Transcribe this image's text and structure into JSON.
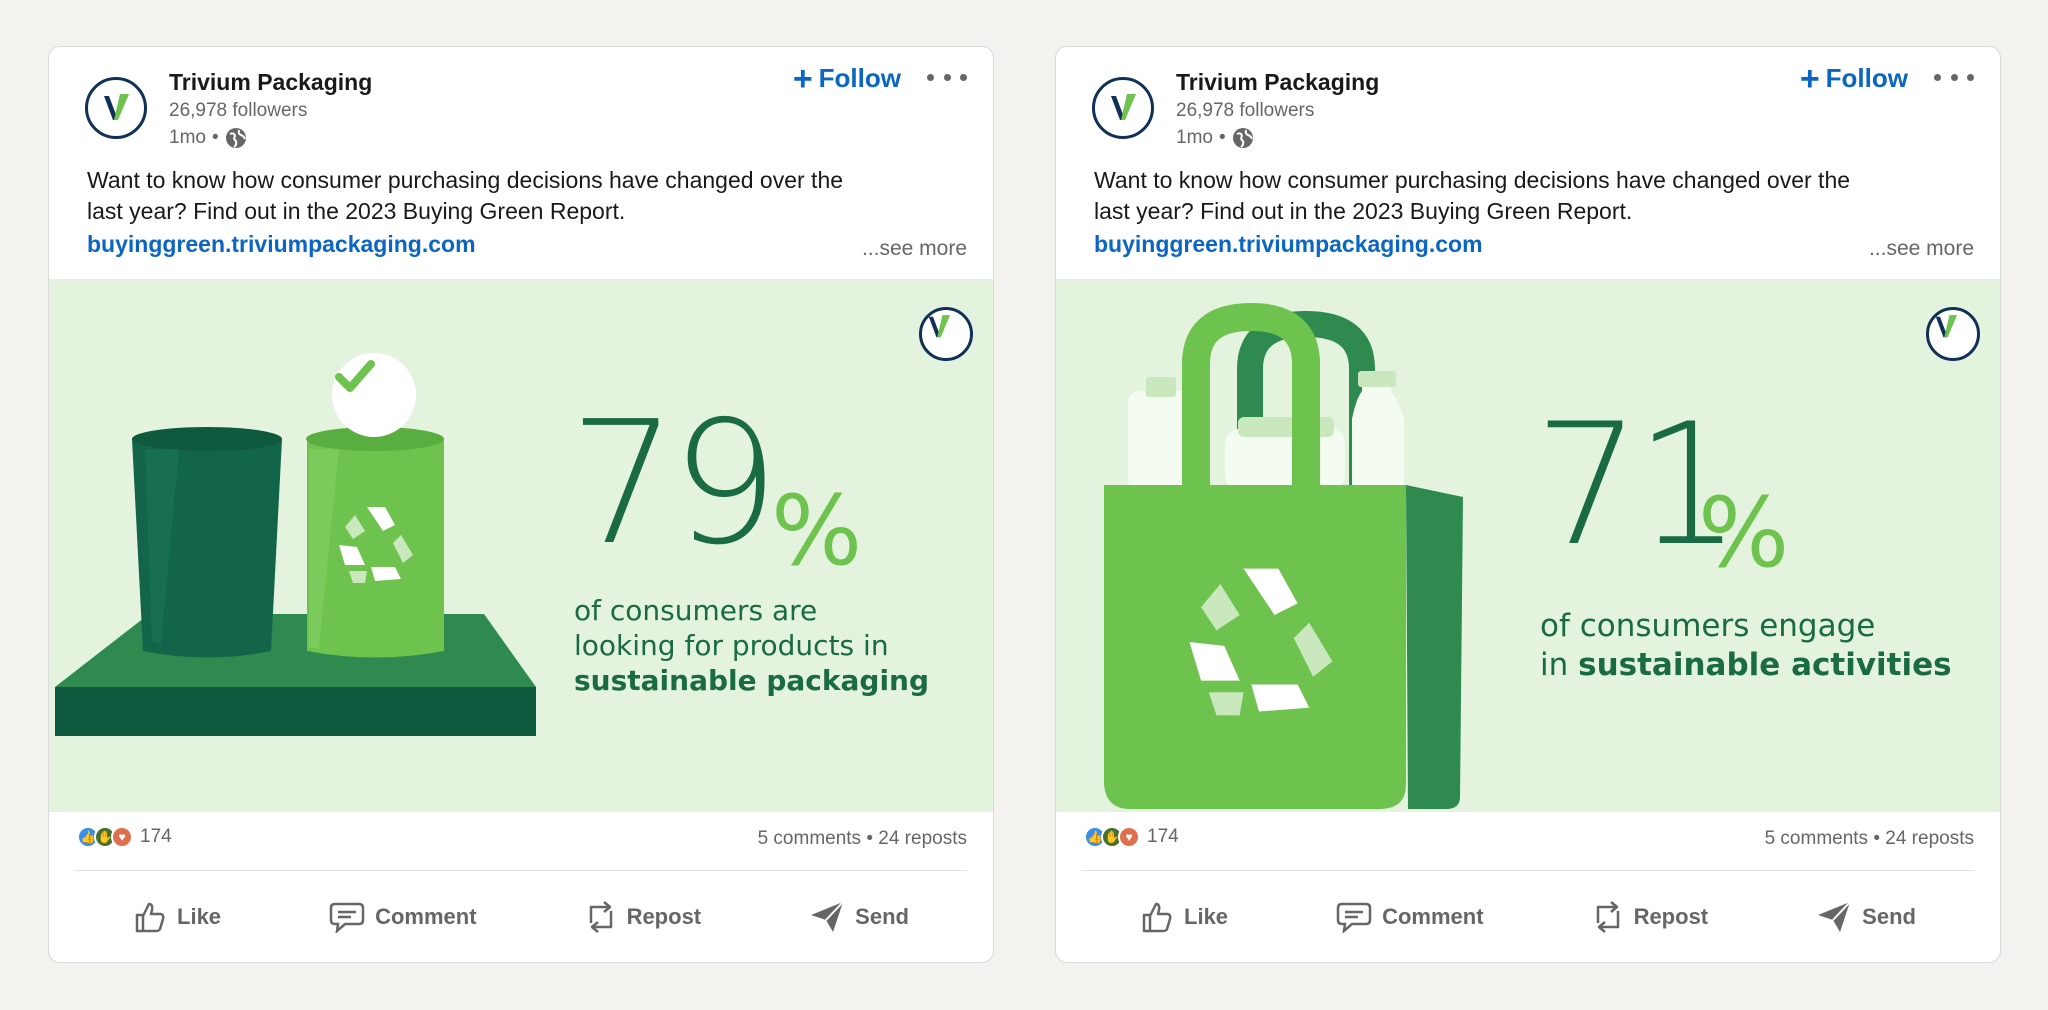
{
  "posts": [
    {
      "company": "Trivium Packaging",
      "followers": "26,978 followers",
      "age": "1mo",
      "dot": "•",
      "follow_label": "Follow",
      "text": "Want to know how consumer purchasing decisions have changed over the last year? Find out in the 2023 Buying Green Report.",
      "link": "buyinggreen.triviumpackaging.com",
      "see_more": "...see more",
      "stat_number": "79",
      "stat_pct": "%",
      "stat_line1": "of consumers are",
      "stat_line2": "looking for products in",
      "stat_bold": "sustainable packaging",
      "reaction_count": "174",
      "counts": "5 comments • 24 reposts",
      "actions": {
        "like": "Like",
        "comment": "Comment",
        "repost": "Repost",
        "send": "Send"
      }
    },
    {
      "company": "Trivium Packaging",
      "followers": "26,978 followers",
      "age": "1mo",
      "dot": "•",
      "follow_label": "Follow",
      "text": "Want to know how consumer purchasing decisions have changed over the last year? Find out in the 2023 Buying Green Report.",
      "link": "buyinggreen.triviumpackaging.com",
      "see_more": "...see more",
      "stat_number": "71",
      "stat_pct": "%",
      "stat_line1": "of consumers engage",
      "stat_prefix": "in",
      "stat_bold": "sustainable activities",
      "reaction_count": "174",
      "counts": "5 comments • 24 reposts",
      "actions": {
        "like": "Like",
        "comment": "Comment",
        "repost": "Repost",
        "send": "Send"
      }
    }
  ],
  "colors": {
    "brand_navy": "#0f3057",
    "brand_green": "#6ec24e",
    "dark_green": "#1a6a44",
    "link_blue": "#0a66c2",
    "image_bg": "#e3f3de"
  },
  "icons": [
    "trivium-logo-icon",
    "globe-icon",
    "plus-icon",
    "more-icon",
    "like-reaction-icon",
    "support-reaction-icon",
    "love-reaction-icon",
    "like-icon",
    "comment-icon",
    "repost-icon",
    "send-icon",
    "recycle-icon",
    "check-icon"
  ]
}
